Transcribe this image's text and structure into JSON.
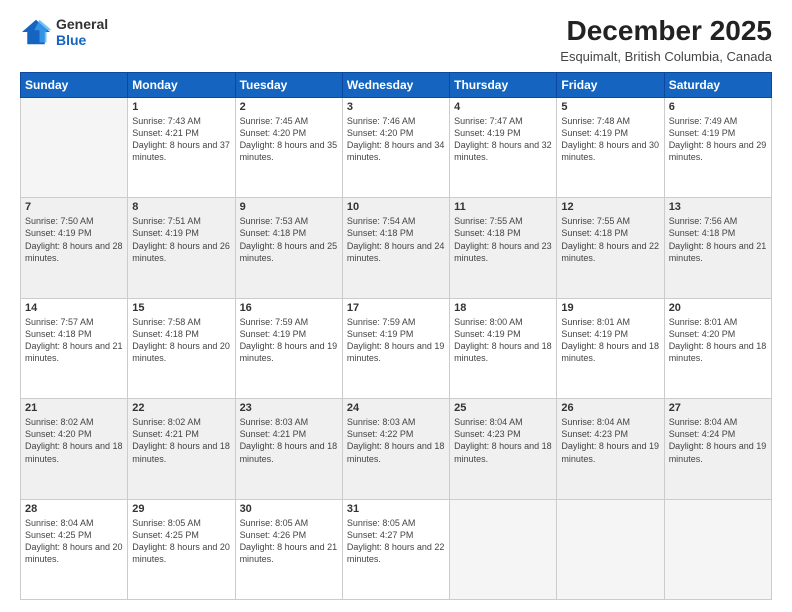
{
  "logo": {
    "line1": "General",
    "line2": "Blue"
  },
  "header": {
    "title": "December 2025",
    "subtitle": "Esquimalt, British Columbia, Canada"
  },
  "days_of_week": [
    "Sunday",
    "Monday",
    "Tuesday",
    "Wednesday",
    "Thursday",
    "Friday",
    "Saturday"
  ],
  "weeks": [
    [
      {
        "day": "",
        "empty": true,
        "sunrise": "",
        "sunset": "",
        "daylight": ""
      },
      {
        "day": "1",
        "empty": false,
        "sunrise": "Sunrise: 7:43 AM",
        "sunset": "Sunset: 4:21 PM",
        "daylight": "Daylight: 8 hours and 37 minutes."
      },
      {
        "day": "2",
        "empty": false,
        "sunrise": "Sunrise: 7:45 AM",
        "sunset": "Sunset: 4:20 PM",
        "daylight": "Daylight: 8 hours and 35 minutes."
      },
      {
        "day": "3",
        "empty": false,
        "sunrise": "Sunrise: 7:46 AM",
        "sunset": "Sunset: 4:20 PM",
        "daylight": "Daylight: 8 hours and 34 minutes."
      },
      {
        "day": "4",
        "empty": false,
        "sunrise": "Sunrise: 7:47 AM",
        "sunset": "Sunset: 4:19 PM",
        "daylight": "Daylight: 8 hours and 32 minutes."
      },
      {
        "day": "5",
        "empty": false,
        "sunrise": "Sunrise: 7:48 AM",
        "sunset": "Sunset: 4:19 PM",
        "daylight": "Daylight: 8 hours and 30 minutes."
      },
      {
        "day": "6",
        "empty": false,
        "sunrise": "Sunrise: 7:49 AM",
        "sunset": "Sunset: 4:19 PM",
        "daylight": "Daylight: 8 hours and 29 minutes."
      }
    ],
    [
      {
        "day": "7",
        "empty": false,
        "sunrise": "Sunrise: 7:50 AM",
        "sunset": "Sunset: 4:19 PM",
        "daylight": "Daylight: 8 hours and 28 minutes."
      },
      {
        "day": "8",
        "empty": false,
        "sunrise": "Sunrise: 7:51 AM",
        "sunset": "Sunset: 4:19 PM",
        "daylight": "Daylight: 8 hours and 26 minutes."
      },
      {
        "day": "9",
        "empty": false,
        "sunrise": "Sunrise: 7:53 AM",
        "sunset": "Sunset: 4:18 PM",
        "daylight": "Daylight: 8 hours and 25 minutes."
      },
      {
        "day": "10",
        "empty": false,
        "sunrise": "Sunrise: 7:54 AM",
        "sunset": "Sunset: 4:18 PM",
        "daylight": "Daylight: 8 hours and 24 minutes."
      },
      {
        "day": "11",
        "empty": false,
        "sunrise": "Sunrise: 7:55 AM",
        "sunset": "Sunset: 4:18 PM",
        "daylight": "Daylight: 8 hours and 23 minutes."
      },
      {
        "day": "12",
        "empty": false,
        "sunrise": "Sunrise: 7:55 AM",
        "sunset": "Sunset: 4:18 PM",
        "daylight": "Daylight: 8 hours and 22 minutes."
      },
      {
        "day": "13",
        "empty": false,
        "sunrise": "Sunrise: 7:56 AM",
        "sunset": "Sunset: 4:18 PM",
        "daylight": "Daylight: 8 hours and 21 minutes."
      }
    ],
    [
      {
        "day": "14",
        "empty": false,
        "sunrise": "Sunrise: 7:57 AM",
        "sunset": "Sunset: 4:18 PM",
        "daylight": "Daylight: 8 hours and 21 minutes."
      },
      {
        "day": "15",
        "empty": false,
        "sunrise": "Sunrise: 7:58 AM",
        "sunset": "Sunset: 4:18 PM",
        "daylight": "Daylight: 8 hours and 20 minutes."
      },
      {
        "day": "16",
        "empty": false,
        "sunrise": "Sunrise: 7:59 AM",
        "sunset": "Sunset: 4:19 PM",
        "daylight": "Daylight: 8 hours and 19 minutes."
      },
      {
        "day": "17",
        "empty": false,
        "sunrise": "Sunrise: 7:59 AM",
        "sunset": "Sunset: 4:19 PM",
        "daylight": "Daylight: 8 hours and 19 minutes."
      },
      {
        "day": "18",
        "empty": false,
        "sunrise": "Sunrise: 8:00 AM",
        "sunset": "Sunset: 4:19 PM",
        "daylight": "Daylight: 8 hours and 18 minutes."
      },
      {
        "day": "19",
        "empty": false,
        "sunrise": "Sunrise: 8:01 AM",
        "sunset": "Sunset: 4:19 PM",
        "daylight": "Daylight: 8 hours and 18 minutes."
      },
      {
        "day": "20",
        "empty": false,
        "sunrise": "Sunrise: 8:01 AM",
        "sunset": "Sunset: 4:20 PM",
        "daylight": "Daylight: 8 hours and 18 minutes."
      }
    ],
    [
      {
        "day": "21",
        "empty": false,
        "sunrise": "Sunrise: 8:02 AM",
        "sunset": "Sunset: 4:20 PM",
        "daylight": "Daylight: 8 hours and 18 minutes."
      },
      {
        "day": "22",
        "empty": false,
        "sunrise": "Sunrise: 8:02 AM",
        "sunset": "Sunset: 4:21 PM",
        "daylight": "Daylight: 8 hours and 18 minutes."
      },
      {
        "day": "23",
        "empty": false,
        "sunrise": "Sunrise: 8:03 AM",
        "sunset": "Sunset: 4:21 PM",
        "daylight": "Daylight: 8 hours and 18 minutes."
      },
      {
        "day": "24",
        "empty": false,
        "sunrise": "Sunrise: 8:03 AM",
        "sunset": "Sunset: 4:22 PM",
        "daylight": "Daylight: 8 hours and 18 minutes."
      },
      {
        "day": "25",
        "empty": false,
        "sunrise": "Sunrise: 8:04 AM",
        "sunset": "Sunset: 4:23 PM",
        "daylight": "Daylight: 8 hours and 18 minutes."
      },
      {
        "day": "26",
        "empty": false,
        "sunrise": "Sunrise: 8:04 AM",
        "sunset": "Sunset: 4:23 PM",
        "daylight": "Daylight: 8 hours and 19 minutes."
      },
      {
        "day": "27",
        "empty": false,
        "sunrise": "Sunrise: 8:04 AM",
        "sunset": "Sunset: 4:24 PM",
        "daylight": "Daylight: 8 hours and 19 minutes."
      }
    ],
    [
      {
        "day": "28",
        "empty": false,
        "sunrise": "Sunrise: 8:04 AM",
        "sunset": "Sunset: 4:25 PM",
        "daylight": "Daylight: 8 hours and 20 minutes."
      },
      {
        "day": "29",
        "empty": false,
        "sunrise": "Sunrise: 8:05 AM",
        "sunset": "Sunset: 4:25 PM",
        "daylight": "Daylight: 8 hours and 20 minutes."
      },
      {
        "day": "30",
        "empty": false,
        "sunrise": "Sunrise: 8:05 AM",
        "sunset": "Sunset: 4:26 PM",
        "daylight": "Daylight: 8 hours and 21 minutes."
      },
      {
        "day": "31",
        "empty": false,
        "sunrise": "Sunrise: 8:05 AM",
        "sunset": "Sunset: 4:27 PM",
        "daylight": "Daylight: 8 hours and 22 minutes."
      },
      {
        "day": "",
        "empty": true,
        "sunrise": "",
        "sunset": "",
        "daylight": ""
      },
      {
        "day": "",
        "empty": true,
        "sunrise": "",
        "sunset": "",
        "daylight": ""
      },
      {
        "day": "",
        "empty": true,
        "sunrise": "",
        "sunset": "",
        "daylight": ""
      }
    ]
  ]
}
